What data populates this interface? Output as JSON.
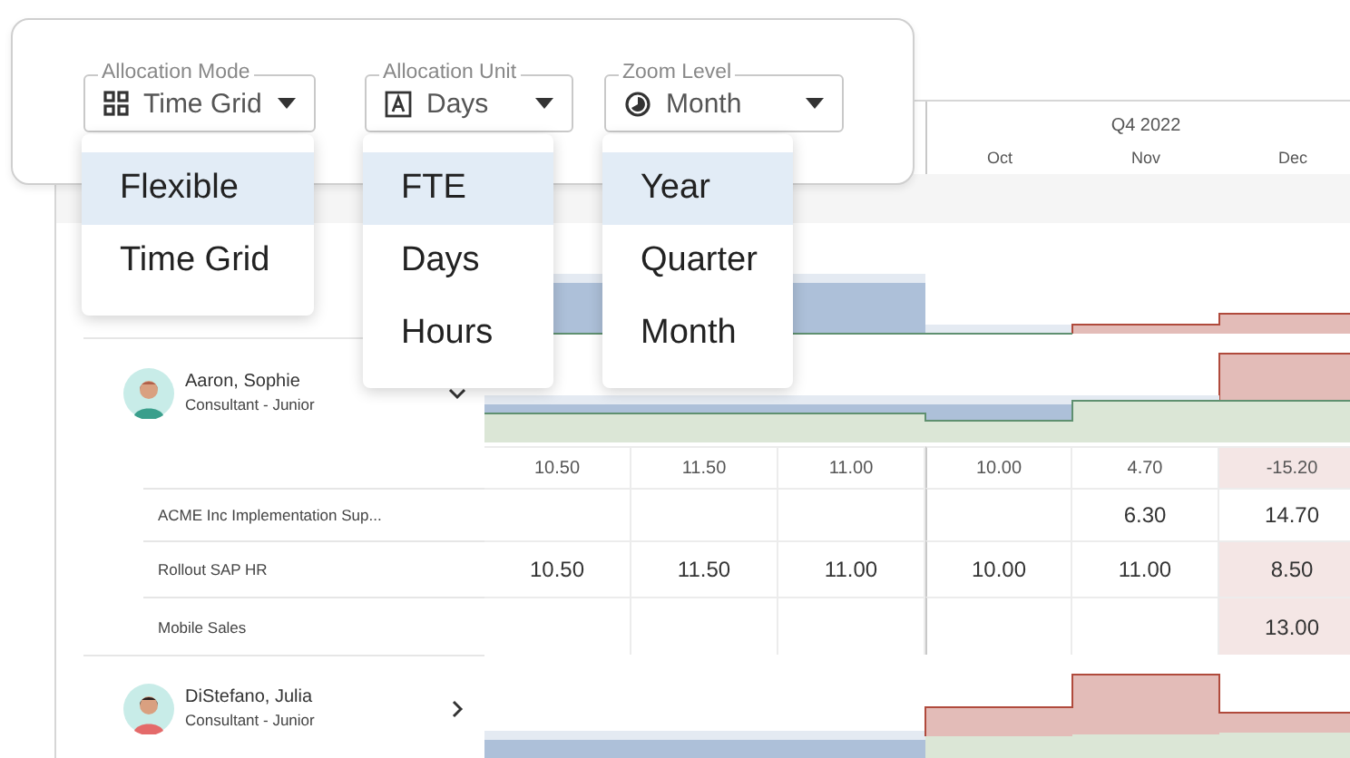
{
  "toolbar": {
    "selects": [
      {
        "label": "Allocation Mode",
        "value": "Time Grid",
        "menu": [
          {
            "label": "Flexible",
            "highlighted": true
          },
          {
            "label": "Time Grid",
            "highlighted": false
          }
        ]
      },
      {
        "label": "Allocation Unit",
        "value": "Days",
        "menu": [
          {
            "label": "FTE",
            "highlighted": true
          },
          {
            "label": "Days",
            "highlighted": false
          },
          {
            "label": "Hours",
            "highlighted": false
          }
        ]
      },
      {
        "label": "Zoom Level",
        "value": "Month",
        "menu": [
          {
            "label": "Year",
            "highlighted": true
          },
          {
            "label": "Quarter",
            "highlighted": false
          },
          {
            "label": "Month",
            "highlighted": false
          }
        ]
      }
    ]
  },
  "timeline": {
    "quarter": "Q4 2022",
    "months": [
      "Oct",
      "Nov",
      "Dec"
    ]
  },
  "resources": [
    {
      "name": "Aaron, Sophie",
      "role": "Consultant - Junior",
      "expanded": true,
      "totals": [
        {
          "value": "10.50",
          "over": false
        },
        {
          "value": "11.50",
          "over": false
        },
        {
          "value": "11.00",
          "over": false
        },
        {
          "value": "10.00",
          "over": false
        },
        {
          "value": "4.70",
          "over": false
        },
        {
          "value": "-15.20",
          "over": true
        }
      ],
      "projects": [
        {
          "name": "ACME Inc Implementation Sup...",
          "cells": [
            null,
            null,
            null,
            null,
            {
              "value": "6.30",
              "over": false
            },
            {
              "value": "14.70",
              "over": false
            }
          ]
        },
        {
          "name": "Rollout SAP HR",
          "cells": [
            {
              "value": "10.50",
              "over": false
            },
            {
              "value": "11.50",
              "over": false
            },
            {
              "value": "11.00",
              "over": false
            },
            {
              "value": "10.00",
              "over": false
            },
            {
              "value": "11.00",
              "over": false
            },
            {
              "value": "8.50",
              "over": true
            }
          ]
        },
        {
          "name": "Mobile Sales",
          "cells": [
            null,
            null,
            null,
            null,
            null,
            {
              "value": "13.00",
              "over": true
            }
          ]
        }
      ]
    },
    {
      "name": "DiStefano, Julia",
      "role": "Consultant - Junior",
      "expanded": false
    }
  ]
}
